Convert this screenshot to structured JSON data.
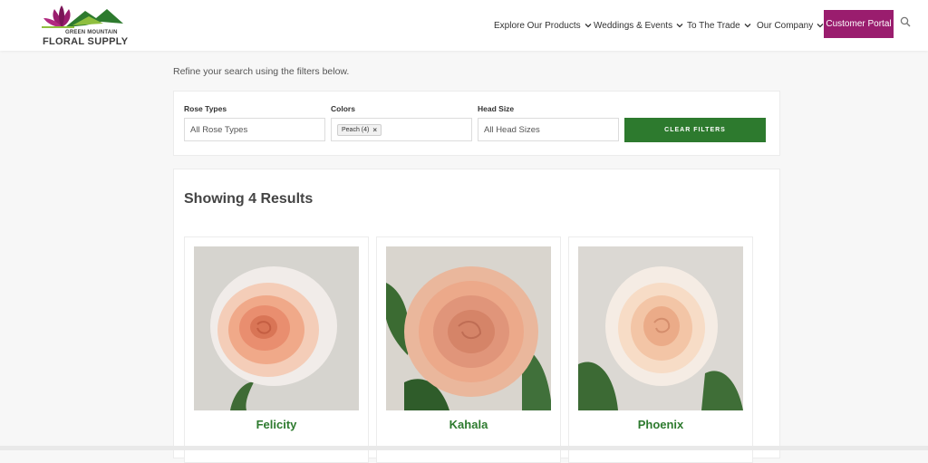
{
  "brand": {
    "line1": "GREEN MOUNTAIN",
    "line2": "FLORAL SUPPLY",
    "colors": {
      "flower": "#9a1d6e",
      "mountain": "#2d7a2e",
      "accent": "#8fbf3f"
    }
  },
  "nav": {
    "items": [
      {
        "label": "Explore Our Products"
      },
      {
        "label": "Weddings & Events"
      },
      {
        "label": "To The Trade"
      },
      {
        "label": "Our Company"
      }
    ],
    "portal_label": "Customer Portal",
    "portal_color": "#9a1d6e"
  },
  "intro_text": "Refine your search using the filters below.",
  "filters": {
    "rose_types": {
      "label": "Rose Types",
      "value": "All Rose Types"
    },
    "colors": {
      "label": "Colors",
      "chip": "Peach (4)",
      "chip_remove": "×"
    },
    "head_size": {
      "label": "Head Size",
      "value": "All Head Sizes"
    },
    "clear_label": "CLEAR FILTERS",
    "clear_color": "#2d7a2e"
  },
  "results": {
    "title": "Showing 4 Results",
    "cards": [
      {
        "name": "Felicity"
      },
      {
        "name": "Kahala"
      },
      {
        "name": "Phoenix"
      }
    ]
  }
}
